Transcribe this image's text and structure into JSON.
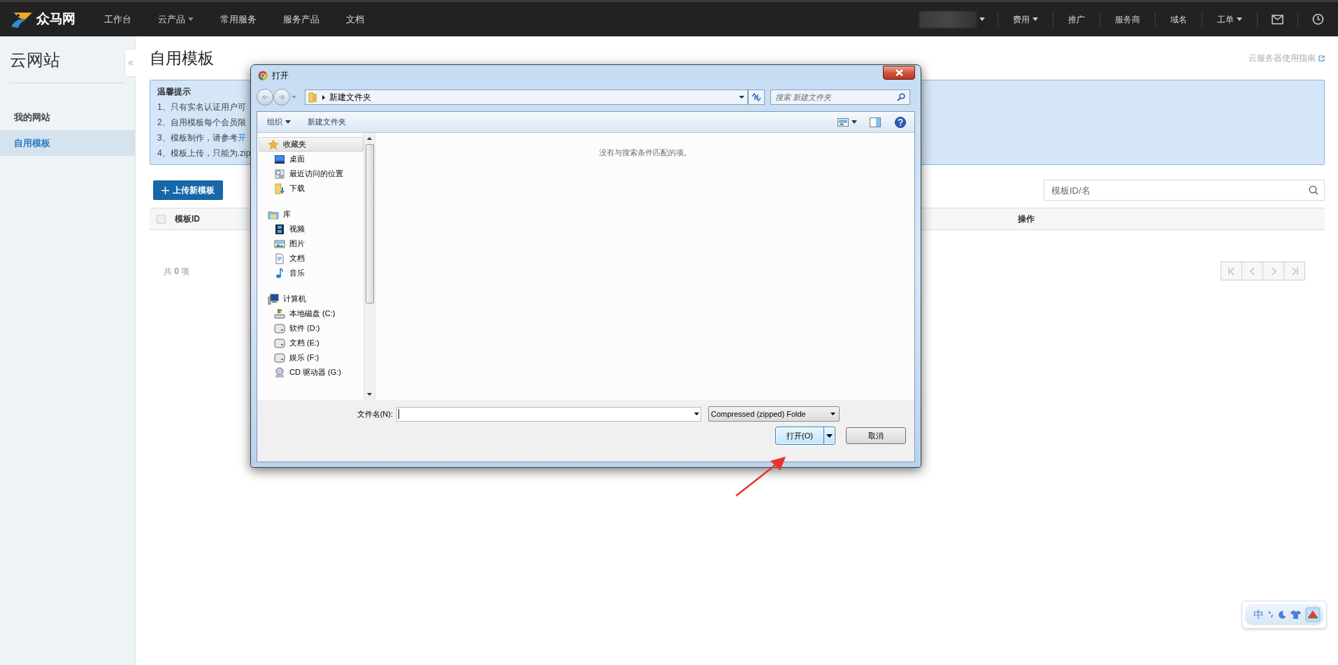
{
  "top_nav": {
    "logo": "众马网",
    "items": [
      {
        "label": "工作台",
        "dropdown": false
      },
      {
        "label": "云产品",
        "dropdown": true
      },
      {
        "label": "常用服务",
        "dropdown": false
      },
      {
        "label": "服务产品",
        "dropdown": false
      },
      {
        "label": "文档",
        "dropdown": false
      }
    ],
    "right_items": [
      {
        "label": "费用",
        "dropdown": true
      },
      {
        "label": "推广",
        "dropdown": false
      },
      {
        "label": "服务商",
        "dropdown": false
      },
      {
        "label": "域名",
        "dropdown": false
      },
      {
        "label": "工单",
        "dropdown": true
      }
    ]
  },
  "sidebar": {
    "title": "云网站",
    "items": [
      {
        "label": "我的网站",
        "selected": false
      },
      {
        "label": "自用模板",
        "selected": true
      }
    ]
  },
  "page": {
    "title": "自用模板",
    "guide_link": "云服务器使用指南",
    "notice": {
      "title": "温馨提示",
      "lines": [
        {
          "text": "1、只有实名认证用户可"
        },
        {
          "text": "2、自用模板每个会员限"
        },
        {
          "text": "3、模板制作，请参考",
          "link": "开"
        },
        {
          "text": "4、模板上传，只能为.zip"
        }
      ]
    },
    "upload_button": "上传新模板",
    "search": {
      "placeholder": "模板ID/名"
    },
    "table": {
      "select_all": {
        "checked": false
      },
      "columns": [
        "模板ID",
        "操作"
      ]
    },
    "total": "共 **0** 项"
  },
  "dialog": {
    "title": "打开",
    "path": "新建文件夹",
    "search_placeholder": "搜索 新建文件夹",
    "organize": "组织",
    "new_folder": "新建文件夹",
    "nav": [
      {
        "label": "收藏夹",
        "kind": "star",
        "selected": true,
        "children": [
          {
            "label": "桌面",
            "kind": "desktop",
            "selected": false
          },
          {
            "label": "最近访问的位置",
            "kind": "recent",
            "selected": false
          },
          {
            "label": "下载",
            "kind": "download",
            "selected": false
          }
        ]
      },
      {
        "label": "库",
        "kind": "library",
        "selected": false,
        "children": [
          {
            "label": "视频",
            "kind": "video",
            "selected": false
          },
          {
            "label": "图片",
            "kind": "image",
            "selected": false
          },
          {
            "label": "文档",
            "kind": "document",
            "selected": false
          },
          {
            "label": "音乐",
            "kind": "music",
            "selected": false
          }
        ]
      },
      {
        "label": "计算机",
        "kind": "computer",
        "selected": false,
        "children": [
          {
            "label": "本地磁盘 (C:)",
            "kind": "sysdrive",
            "selected": false
          },
          {
            "label": "软件 (D:)",
            "kind": "drive",
            "selected": false
          },
          {
            "label": "文档 (E:)",
            "kind": "drive",
            "selected": false
          },
          {
            "label": "娱乐 (F:)",
            "kind": "drive",
            "selected": false
          },
          {
            "label": "CD 驱动器 (G:)",
            "kind": "disc",
            "selected": false
          }
        ]
      }
    ],
    "empty_message": "没有与搜索条件匹配的项。",
    "filename_label": "文件名(N):",
    "filetype": "Compressed (zipped) Folde",
    "open_button": "打开(O)",
    "cancel_button": "取消"
  },
  "ime_bar": {
    "label": "中"
  }
}
